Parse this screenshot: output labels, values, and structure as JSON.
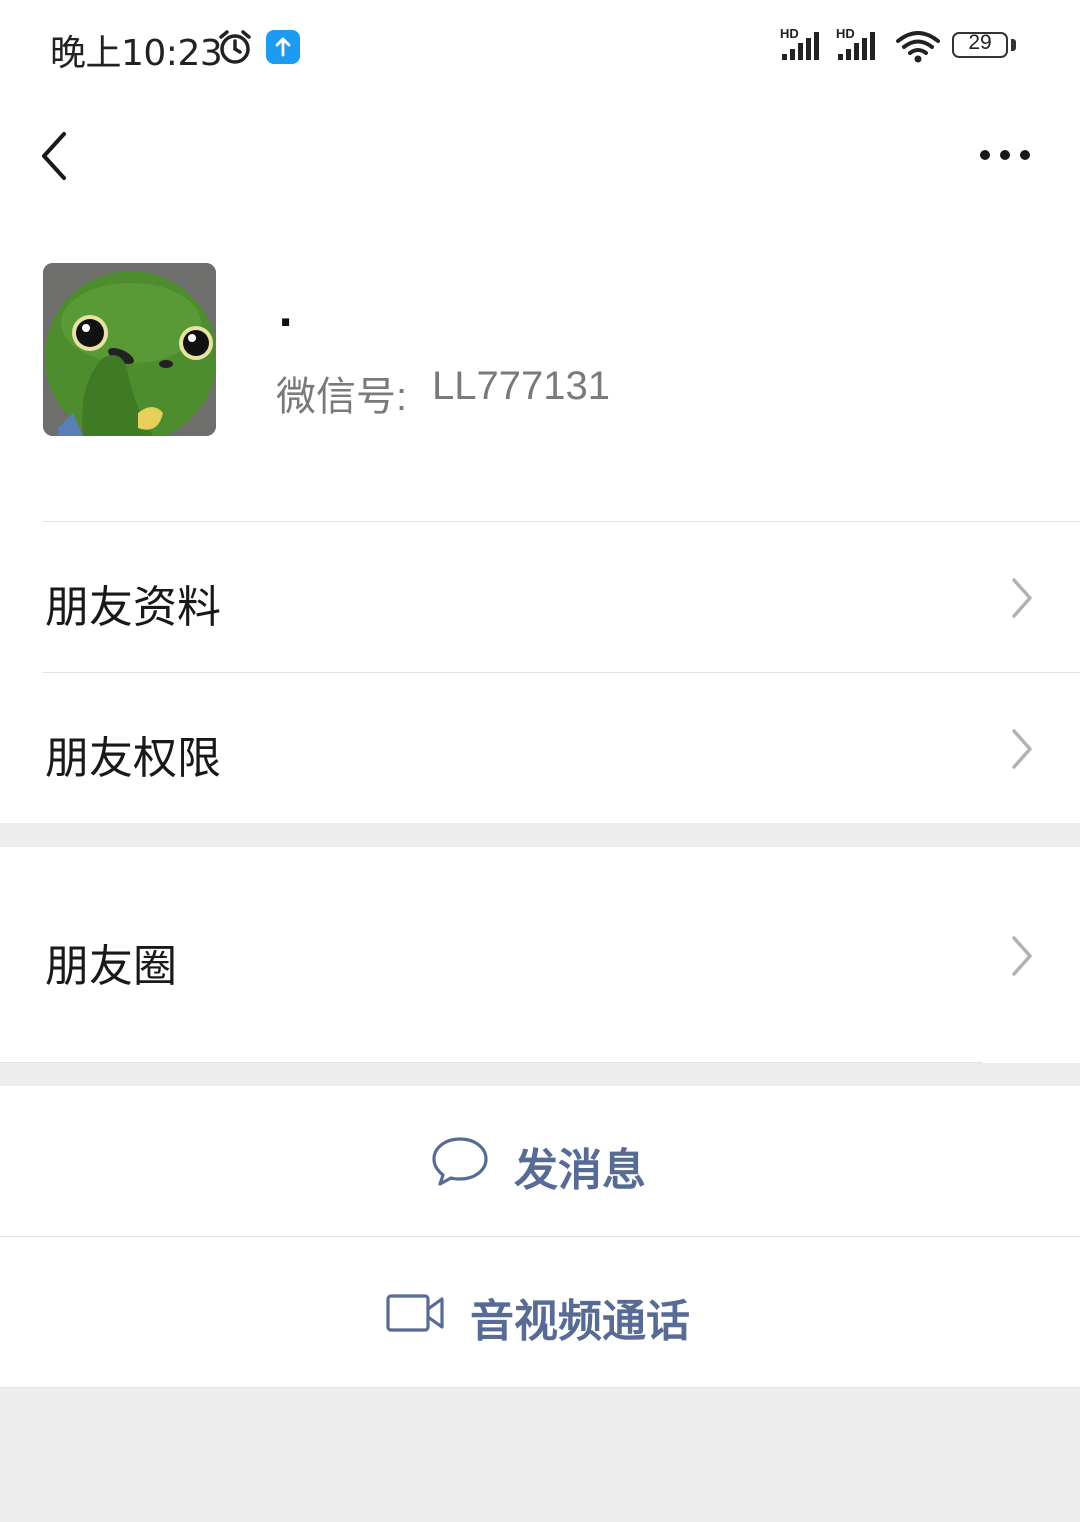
{
  "status_bar": {
    "time": "晚上10:23",
    "signal_1_label": "HD",
    "signal_2_label": "HD",
    "battery": "29",
    "icons": [
      "alarm-icon",
      "upload-icon",
      "signal-icon",
      "signal-icon",
      "wifi-icon",
      "battery-icon"
    ]
  },
  "nav": {
    "back_icon": "chevron-left-icon",
    "more_icon": "more-dots-icon"
  },
  "profile": {
    "avatar_icon": "green-frog-avatar",
    "nickname": "·",
    "wechat_id_label": "微信号:",
    "wechat_id": "LL777131"
  },
  "menu": {
    "friend_info": "朋友资料",
    "friend_permissions": "朋友权限",
    "moments": "朋友圈"
  },
  "actions": {
    "send_message": "发消息",
    "video_call": "音视频通话"
  },
  "colors": {
    "accent_link": "#576b95",
    "background": "#ededed",
    "card": "#ffffff",
    "secondary_text": "#7a7a7a"
  }
}
